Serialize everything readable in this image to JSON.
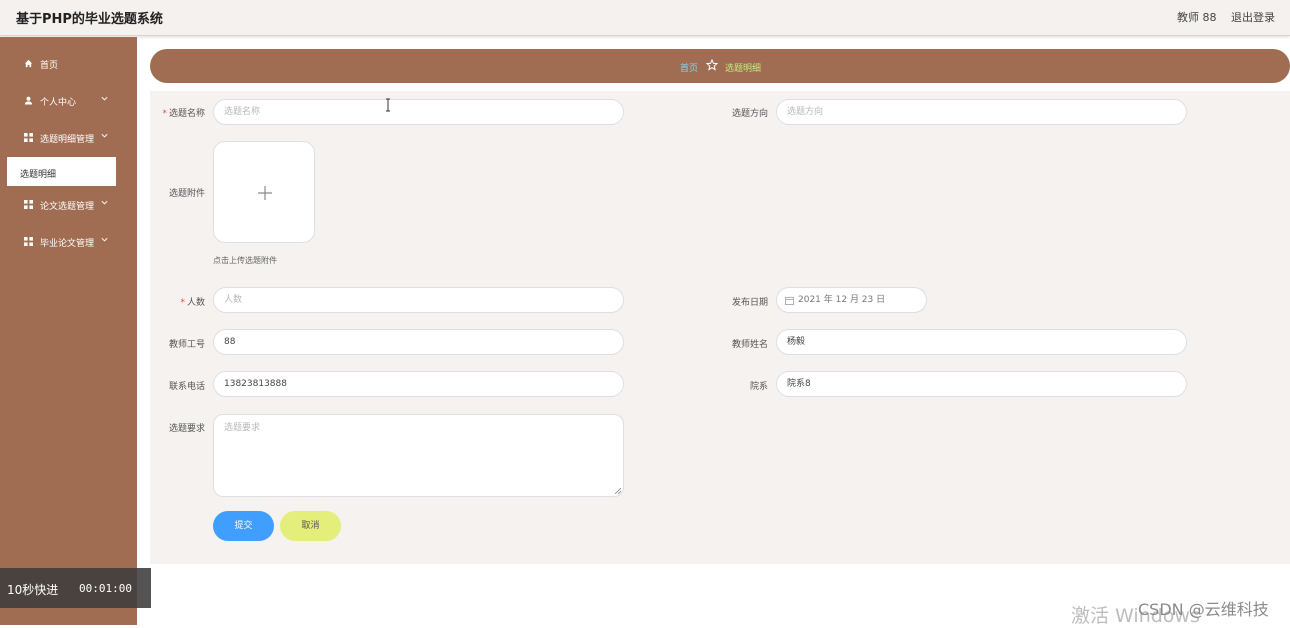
{
  "header": {
    "title": "基于PHP的毕业选题系统",
    "user": "教师 88",
    "logout": "退出登录"
  },
  "sidebar": {
    "items": [
      {
        "label": "首页",
        "icon": "home-icon"
      },
      {
        "label": "个人中心",
        "icon": "user-icon"
      },
      {
        "label": "选题明细管理",
        "icon": "grid-icon"
      },
      {
        "label": "论文选题管理",
        "icon": "grid-icon"
      },
      {
        "label": "毕业论文管理",
        "icon": "grid-icon"
      }
    ],
    "active_sub": "选题明细"
  },
  "breadcrumb": {
    "home": "首页",
    "current": "选题明细"
  },
  "form": {
    "topic_name": {
      "label": "选题名称",
      "placeholder": "选题名称",
      "required": true
    },
    "direction": {
      "label": "选题方向",
      "placeholder": "选题方向"
    },
    "attachment": {
      "label": "选题附件",
      "hint": "点击上传选题附件"
    },
    "count": {
      "label": "人数",
      "placeholder": "人数",
      "required": true
    },
    "publish_date": {
      "label": "发布日期",
      "value": "2021 年 12 月 23 日"
    },
    "teacher_id": {
      "label": "教师工号",
      "value": "88"
    },
    "teacher_name": {
      "label": "教师姓名",
      "value": "杨毅"
    },
    "phone": {
      "label": "联系电话",
      "value": "13823813888"
    },
    "department": {
      "label": "院系",
      "value": "院系8"
    },
    "requirement": {
      "label": "选题要求",
      "placeholder": "选题要求"
    },
    "submit": "提交",
    "cancel": "取消"
  },
  "overlay": {
    "label": "10秒快进",
    "time": "00:01:00"
  },
  "watermark": {
    "activate": "激活 Windows",
    "csdn": "CSDN @云维科技"
  },
  "colors": {
    "sidebar": "#a06d52",
    "breadcrumb_home": "#7fd7ec",
    "breadcrumb_current": "#c5ea7e",
    "submit": "#409eff",
    "cancel": "#e4ee7a",
    "required": "#e6493b"
  }
}
